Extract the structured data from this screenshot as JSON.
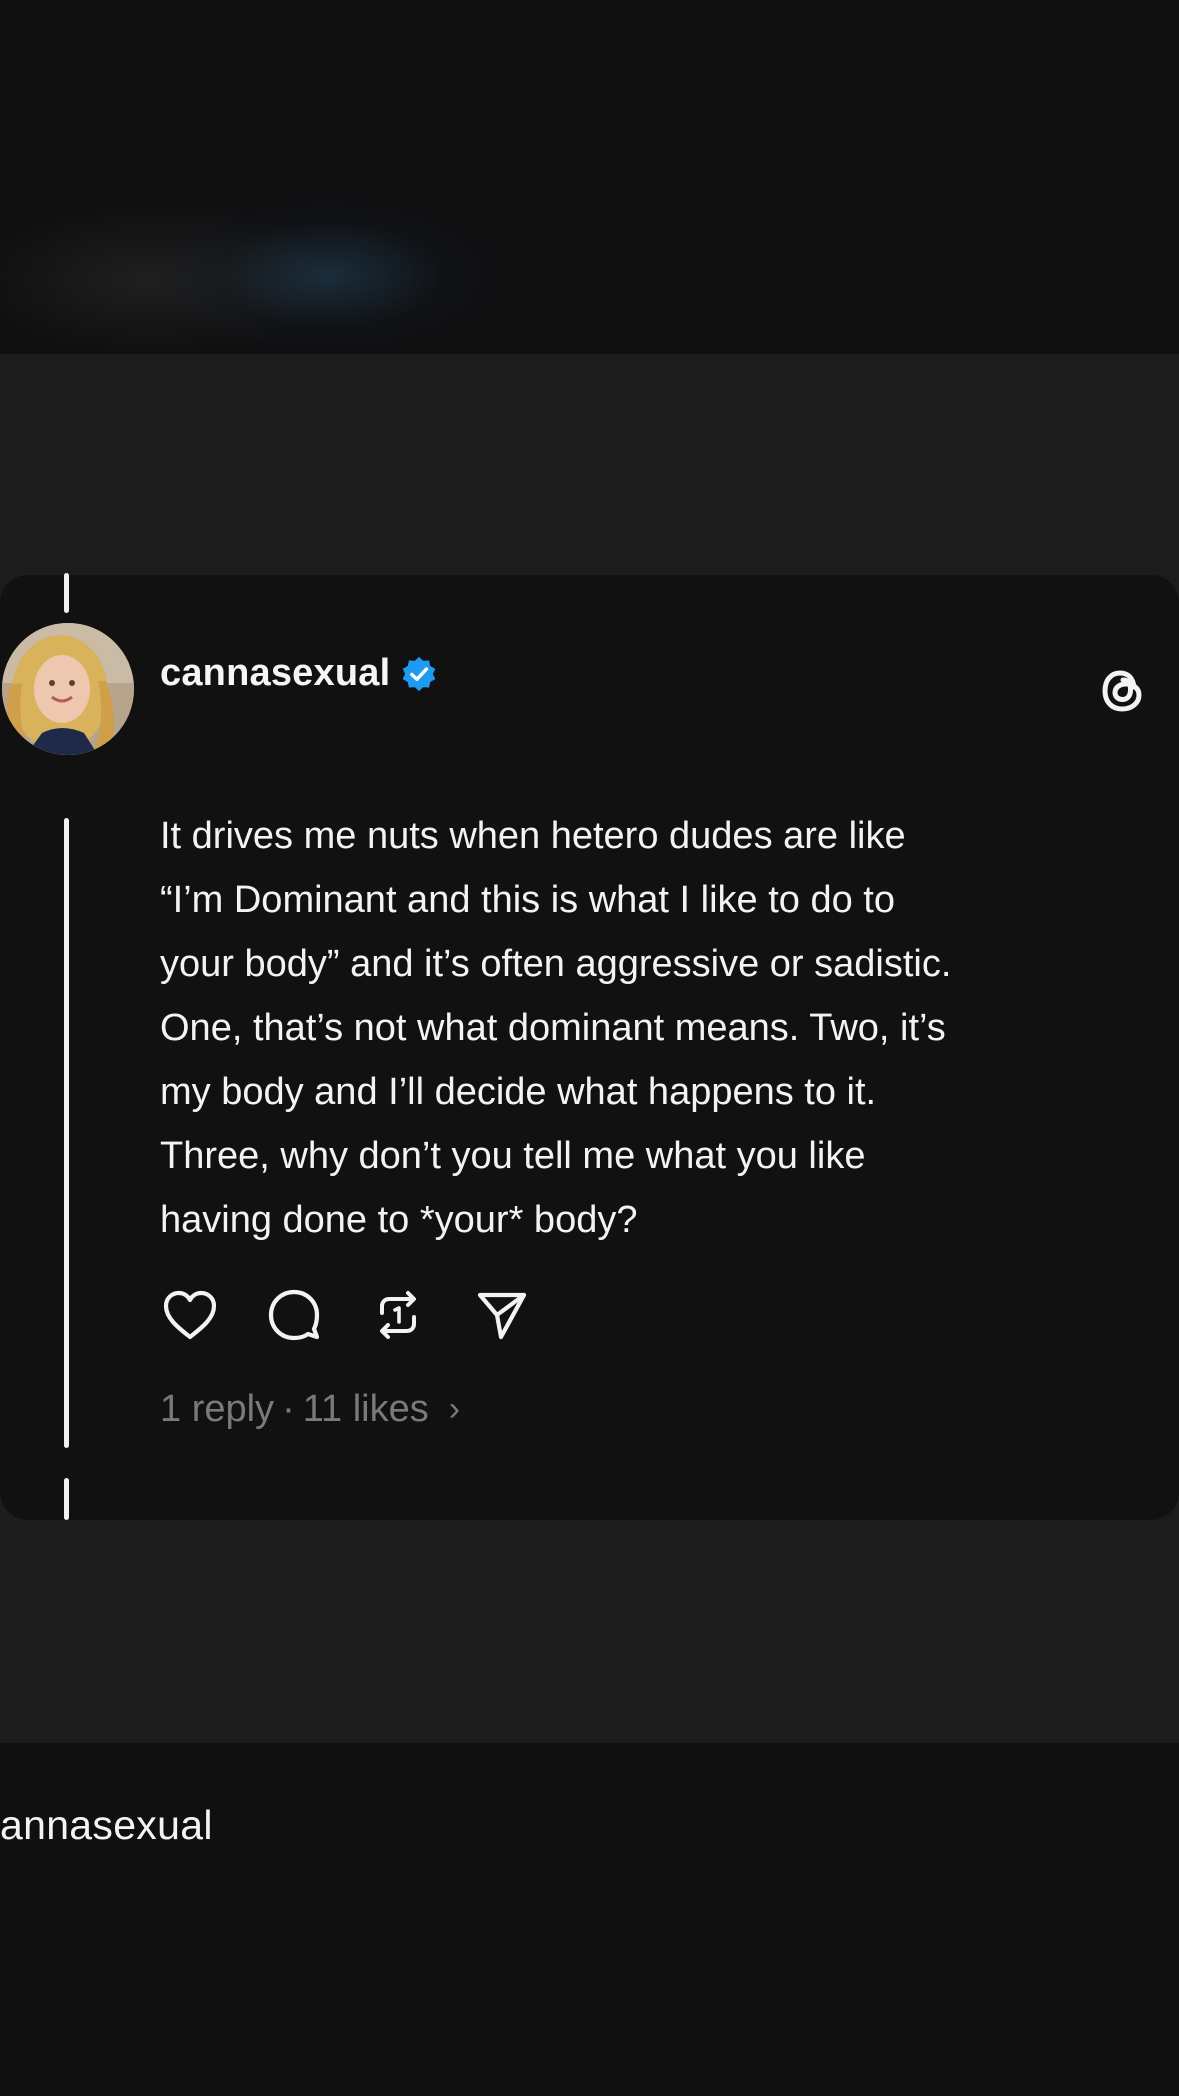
{
  "post": {
    "username": "cannasexual",
    "verified": true,
    "text": "It drives me nuts when hetero dudes are like\n“I’m Dominant and this is what I like to do to\nyour body” and it’s often aggressive or sadistic.\nOne, that’s not what dominant means. Two, it’s\nmy body and I’ll decide what happens to it.\nThree, why don’t you tell me what you like\nhaving done to *your* body?",
    "stats": {
      "replies": "1 reply",
      "separator": "·",
      "likes": "11 likes",
      "chevron": "›"
    },
    "actions": [
      {
        "name": "like",
        "icon": "heart-icon"
      },
      {
        "name": "reply",
        "icon": "comment-icon"
      },
      {
        "name": "repost",
        "icon": "repost-icon"
      },
      {
        "name": "share",
        "icon": "send-icon"
      }
    ]
  },
  "footer": {
    "caption": "annasexual"
  },
  "colors": {
    "background": "#0e0e0e",
    "card": "#111111",
    "band": "#1c1c1c",
    "text": "#f3f3f3",
    "muted": "#7a7a7a",
    "verified": "#1d9bf0"
  },
  "icons": {
    "brand": "threads-logo-icon",
    "verified": "verified-badge-icon"
  }
}
